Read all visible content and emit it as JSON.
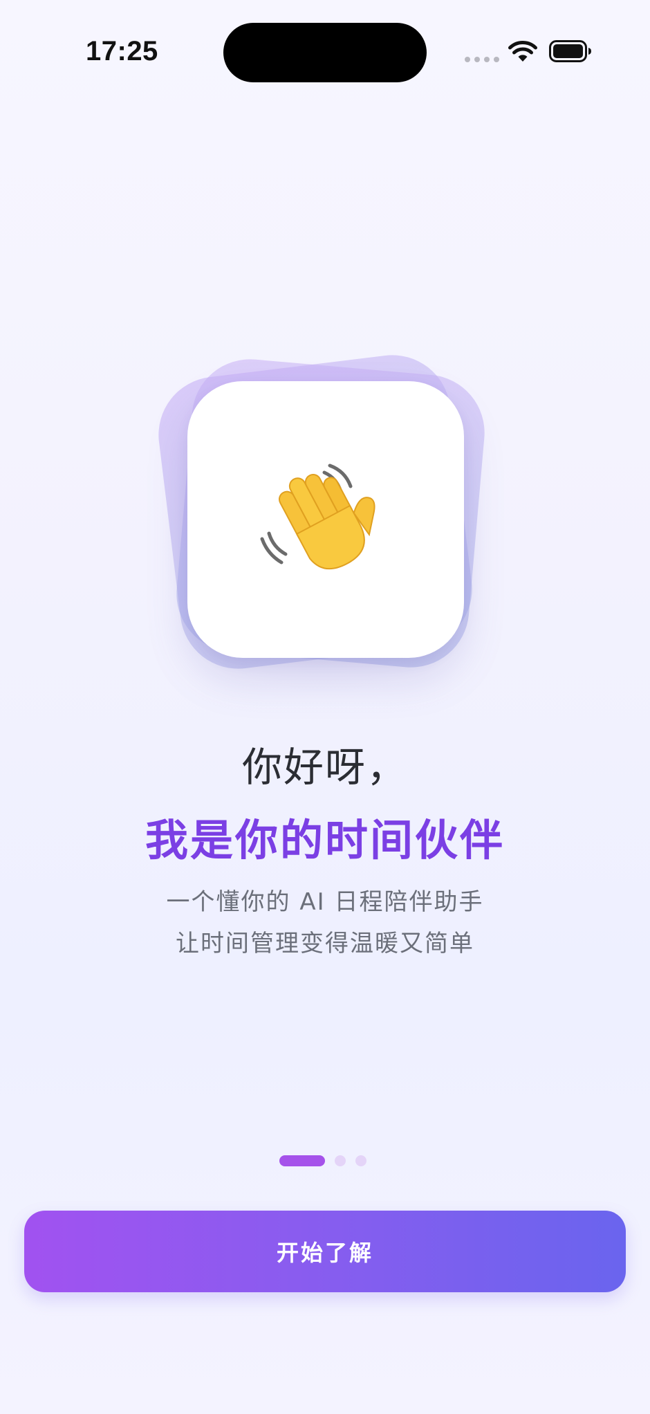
{
  "status_bar": {
    "time": "17:25",
    "icons": [
      "cellular-signal-icon",
      "wifi-icon",
      "battery-icon"
    ]
  },
  "hero": {
    "emoji": "👋",
    "icon": "waving-hand-icon"
  },
  "greeting": "你好呀，",
  "headline": "我是你的时间伙伴",
  "subtitle_line1": "一个懂你的 AI 日程陪伴助手",
  "subtitle_line2": "让时间管理变得温暖又简单",
  "pager": {
    "total_pages": 3,
    "current_page": 1
  },
  "cta_label": "开始了解",
  "colors": {
    "headline": "#7b3fe4",
    "cta_gradient_start": "#a152f0",
    "cta_gradient_end": "#6a64ee",
    "pager_active": "#a552ea",
    "pager_inactive": "#e4d4f8"
  }
}
